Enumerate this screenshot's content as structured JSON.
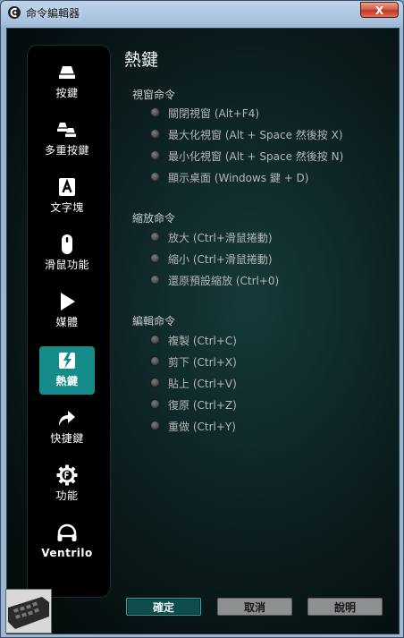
{
  "window": {
    "title": "命令編輯器",
    "close_label": "X"
  },
  "sidebar": {
    "items": [
      {
        "label": "按鍵",
        "icon": "key-icon",
        "active": false
      },
      {
        "label": "多重按鍵",
        "icon": "multi-key-icon",
        "active": false
      },
      {
        "label": "文字塊",
        "icon": "text-block-icon",
        "active": false
      },
      {
        "label": "滑鼠功能",
        "icon": "mouse-icon",
        "active": false
      },
      {
        "label": "媒體",
        "icon": "play-icon",
        "active": false
      },
      {
        "label": "熱鍵",
        "icon": "hotkey-icon",
        "active": true
      },
      {
        "label": "快捷鍵",
        "icon": "shortcut-arrow-icon",
        "active": false
      },
      {
        "label": "功能",
        "icon": "function-gear-icon",
        "active": false
      },
      {
        "label": "Ventrilo",
        "icon": "headset-icon",
        "active": false
      }
    ]
  },
  "main": {
    "section_title": "熱鍵",
    "groups": [
      {
        "title": "視窗命令",
        "options": [
          "關閉視窗 (Alt+F4)",
          "最大化視窗 (Alt + Space 然後按 X)",
          "最小化視窗 (Alt + Space 然後按 N)",
          "顯示桌面 (Windows 鍵 + D)"
        ]
      },
      {
        "title": "縮放命令",
        "options": [
          "放大 (Ctrl+滑鼠捲動)",
          "縮小 (Ctrl+滑鼠捲動)",
          "還原預設縮放 (Ctrl+0)"
        ]
      },
      {
        "title": "編輯命令",
        "options": [
          "複製 (Ctrl+C)",
          "剪下 (Ctrl+X)",
          "貼上 (Ctrl+V)",
          "復原 (Ctrl+Z)",
          "重做 (Ctrl+Y)"
        ]
      }
    ]
  },
  "footer": {
    "ok_label": "確定",
    "cancel_label": "取消",
    "help_label": "說明"
  },
  "colors": {
    "accent": "#168c8a",
    "sidebar_bg": "#000000",
    "panel_bg": "#0d2122"
  }
}
